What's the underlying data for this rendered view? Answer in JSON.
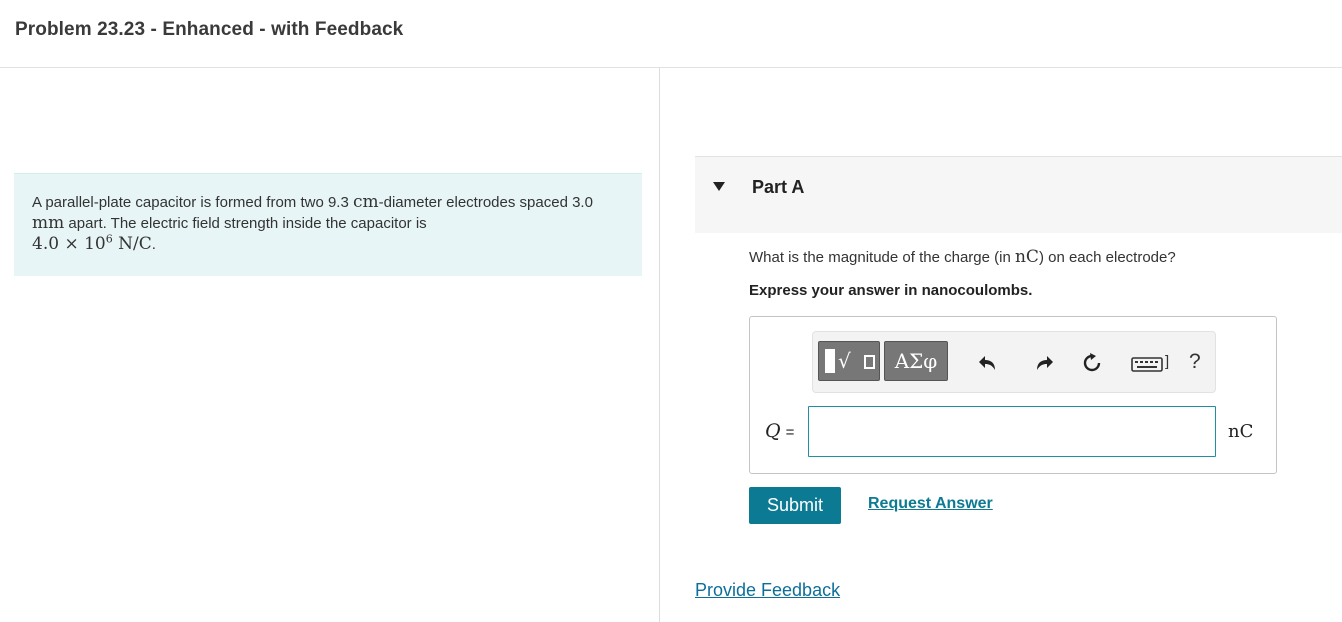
{
  "header": {
    "title": "Problem 23.23 - Enhanced - with Feedback"
  },
  "problem": {
    "text_1": "A parallel-plate capacitor is formed from two 9.3 ",
    "unit_cm": "cm",
    "text_2": "-diameter electrodes spaced 3.0 ",
    "unit_mm": "mm",
    "text_3": " apart. The electric field strength inside the capacitor is ",
    "field_base": "4.0 × 10",
    "field_exp": "6",
    "field_unit": " N/C",
    "text_end": "."
  },
  "part": {
    "label": "Part A",
    "question_before": "What is the magnitude of the charge (in ",
    "question_unit": "nC",
    "question_after": ") on each electrode?",
    "instruction": "Express your answer in nanocoulombs."
  },
  "toolbar": {
    "templates_icon": "math-templates-icon",
    "greek_label": "ΑΣφ",
    "keyboard_bracket": "]",
    "help_label": "?"
  },
  "answer": {
    "variable": "Q",
    "equals": "=",
    "value": "",
    "unit": "nC"
  },
  "actions": {
    "submit_label": "Submit",
    "request_label": "Request Answer",
    "feedback_label": "Provide Feedback"
  },
  "colors": {
    "accent": "#0d7a93",
    "problem_bg": "#e7f5f6",
    "toolbar_button": "#777777"
  }
}
